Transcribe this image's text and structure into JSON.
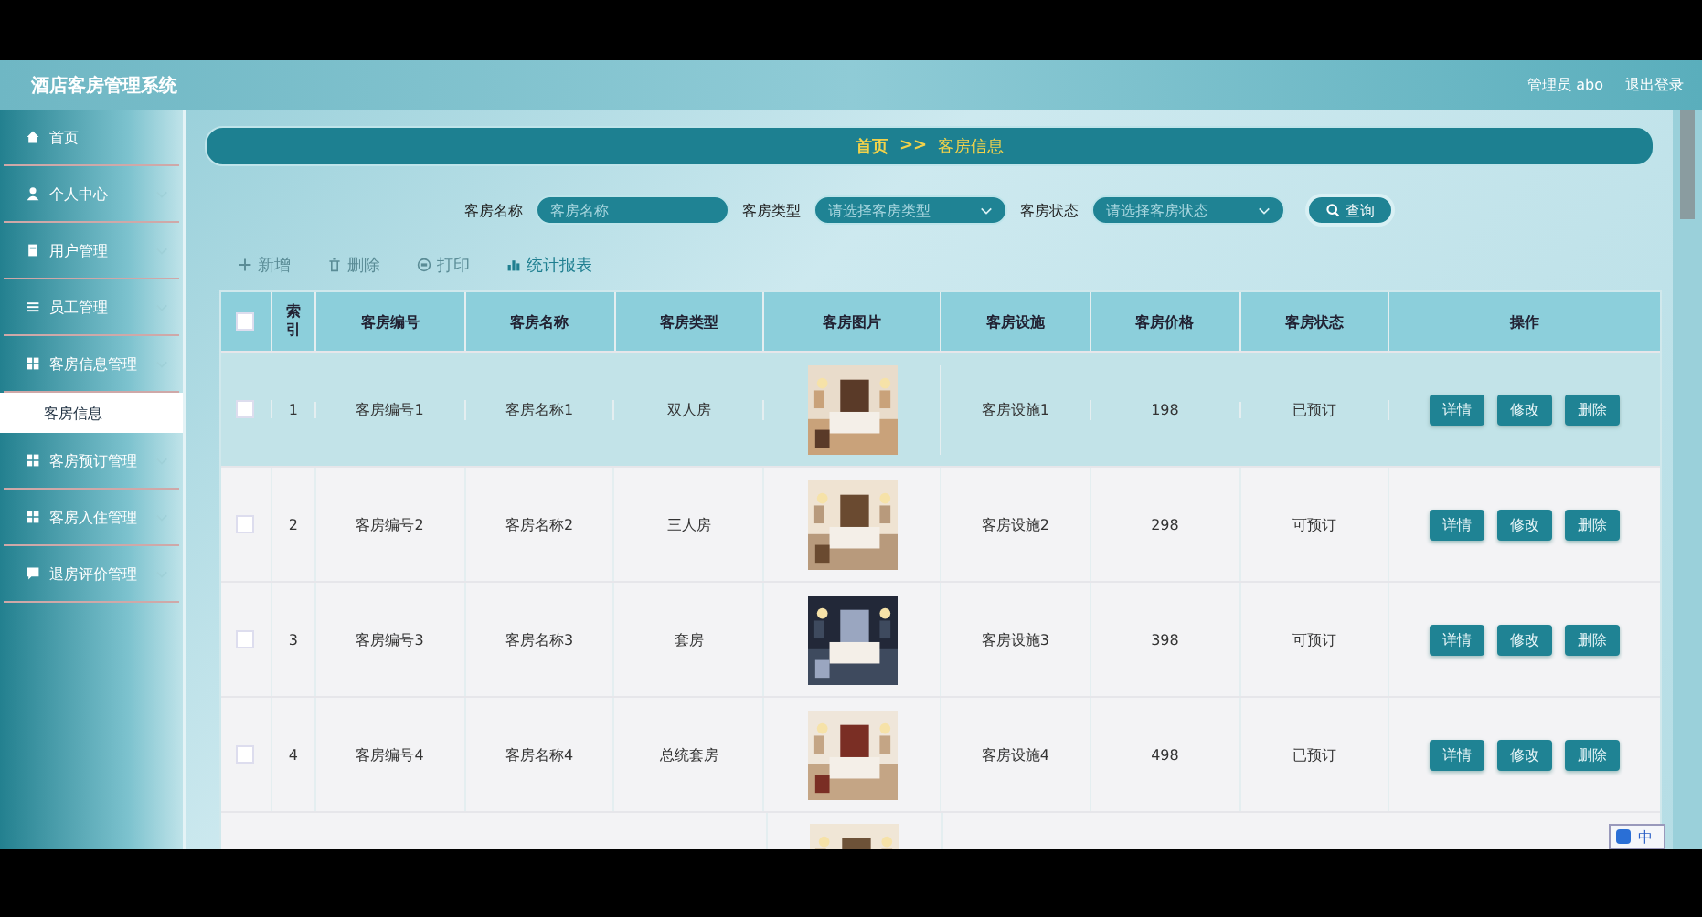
{
  "header": {
    "title": "酒店客房管理系统",
    "user": "管理员 abo",
    "logout": "退出登录"
  },
  "sidebar": {
    "items": [
      {
        "kind": "home",
        "label": "首页",
        "expandable": false
      },
      {
        "kind": "person",
        "label": "个人中心",
        "expandable": true
      },
      {
        "kind": "doc",
        "label": "用户管理",
        "expandable": true
      },
      {
        "kind": "list",
        "label": "员工管理",
        "expandable": true
      },
      {
        "kind": "grid",
        "label": "客房信息管理",
        "expandable": true,
        "children": [
          {
            "label": "客房信息",
            "selected": true
          }
        ]
      },
      {
        "kind": "grid",
        "label": "客房预订管理",
        "expandable": true
      },
      {
        "kind": "grid",
        "label": "客房入住管理",
        "expandable": true
      },
      {
        "kind": "chat",
        "label": "退房评价管理",
        "expandable": true
      }
    ]
  },
  "breadcrumb": {
    "home": "首页",
    "separator": ">>",
    "current": "客房信息"
  },
  "search": {
    "fields": [
      {
        "kind": "input",
        "label": "客房名称",
        "placeholder": "客房名称"
      },
      {
        "kind": "select",
        "label": "客房类型",
        "placeholder": "请选择客房类型"
      },
      {
        "kind": "select",
        "label": "客房状态",
        "placeholder": "请选择客房状态"
      }
    ],
    "button": "查询"
  },
  "toolbar": [
    {
      "kind": "plus",
      "label": "新增"
    },
    {
      "kind": "trash",
      "label": "删除"
    },
    {
      "kind": "print",
      "label": "打印"
    },
    {
      "kind": "chart",
      "label": "统计报表"
    }
  ],
  "table": {
    "all_checked": false,
    "columns": [
      "索引",
      "客房编号",
      "客房名称",
      "客房类型",
      "客房图片",
      "客房设施",
      "客房价格",
      "客房状态",
      "操作"
    ],
    "rows": [
      {
        "selected": true,
        "checked": false,
        "index": "1",
        "code": "客房编号1",
        "name": "客房名称1",
        "type": "双人房",
        "facility": "客房设施1",
        "price": "198",
        "status": "已预订",
        "actions": [
          "详情",
          "修改",
          "删除"
        ]
      },
      {
        "selected": false,
        "checked": false,
        "index": "2",
        "code": "客房编号2",
        "name": "客房名称2",
        "type": "三人房",
        "facility": "客房设施2",
        "price": "298",
        "status": "可预订",
        "actions": [
          "详情",
          "修改",
          "删除"
        ]
      },
      {
        "selected": false,
        "checked": false,
        "index": "3",
        "code": "客房编号3",
        "name": "客房名称3",
        "type": "套房",
        "facility": "客房设施3",
        "price": "398",
        "status": "可预订",
        "actions": [
          "详情",
          "修改",
          "删除"
        ]
      },
      {
        "selected": false,
        "checked": false,
        "index": "4",
        "code": "客房编号4",
        "name": "客房名称4",
        "type": "总统套房",
        "facility": "客房设施4",
        "price": "498",
        "status": "已预订",
        "actions": [
          "详情",
          "修改",
          "删除"
        ]
      }
    ],
    "more_rows_below": true
  },
  "ime_bar": {
    "mode": "中"
  }
}
